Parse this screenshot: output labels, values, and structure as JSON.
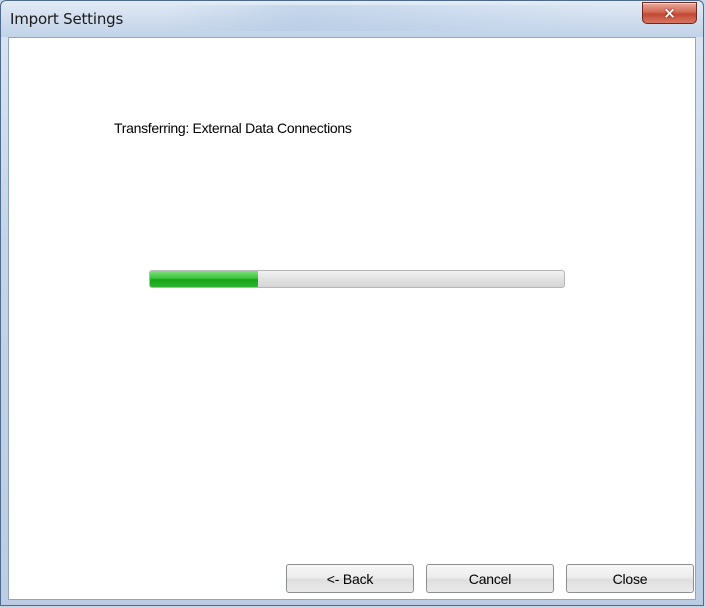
{
  "window": {
    "title": "Import Settings",
    "close_icon": "×"
  },
  "status": {
    "text": "Transferring: External Data Connections"
  },
  "progress": {
    "fraction": 0.26
  },
  "buttons": {
    "back": "<- Back",
    "cancel": "Cancel",
    "close": "Close"
  },
  "colors": {
    "progress_fill": "#16a516",
    "close_button": "#c24a33"
  },
  "icons": {
    "close": "close-icon"
  }
}
